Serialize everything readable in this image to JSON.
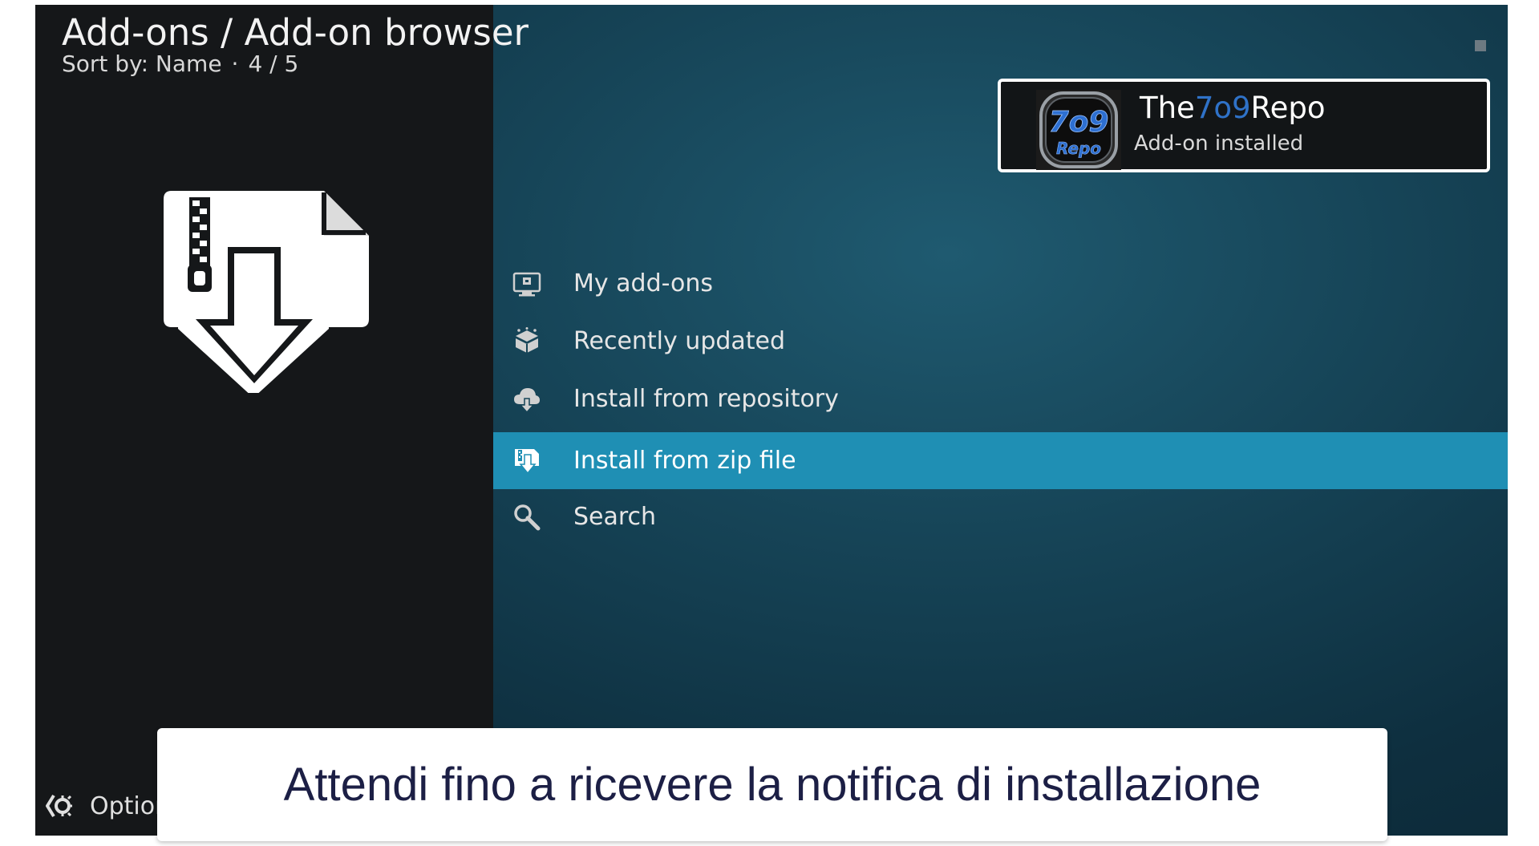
{
  "header": {
    "title": "Add-ons / Add-on browser",
    "sort_label": "Sort by: Name",
    "separator": "·",
    "page_count": "4 / 5"
  },
  "notification": {
    "title_prefix": "The",
    "title_accent": "7o9",
    "title_suffix": "Repo",
    "subtitle": "Add-on installed",
    "logo_text_top": "7o9",
    "logo_text_bottom": "Repo",
    "accent_color": "#2f72c8"
  },
  "menu": {
    "items": [
      {
        "label": "My add-ons",
        "icon": "monitor-addons-icon"
      },
      {
        "label": "Recently updated",
        "icon": "box-updated-icon"
      },
      {
        "label": "Install from repository",
        "icon": "cloud-download-icon"
      },
      {
        "label": "Install from zip file",
        "icon": "zip-install-icon",
        "selected": true
      },
      {
        "label": "Search",
        "icon": "search-icon"
      }
    ],
    "selected_color": "#1f8fb4"
  },
  "footer": {
    "options_label": "Options"
  },
  "caption": {
    "text": "Attendi fino a ricevere la notifica di installazione"
  }
}
